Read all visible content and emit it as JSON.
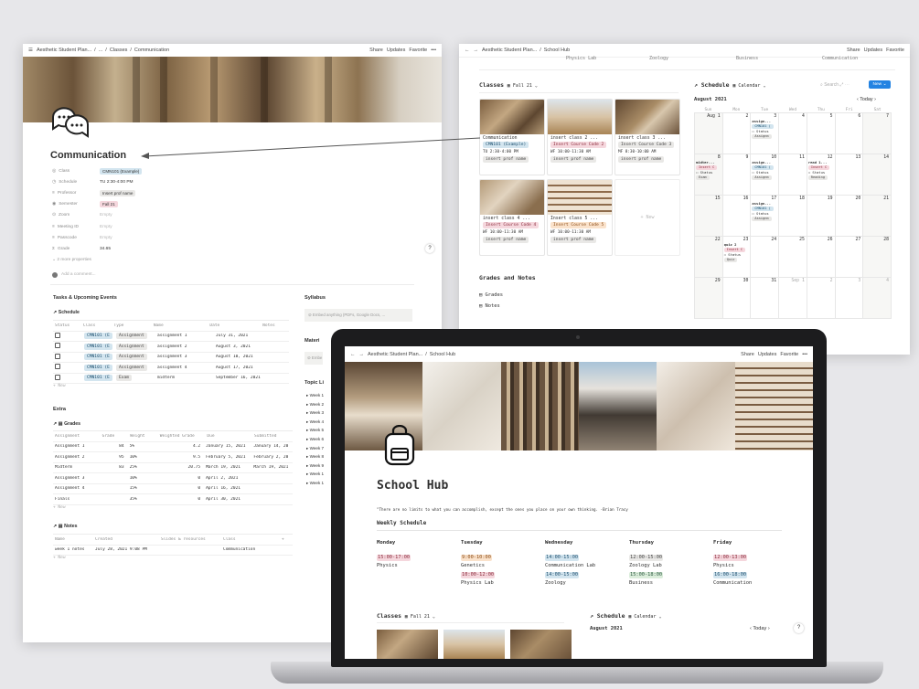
{
  "left_window": {
    "breadcrumb": [
      "Aesthetic Student Plan...",
      "...",
      "Classes",
      "Communication"
    ],
    "actions": [
      "Share",
      "Updates",
      "Favorite",
      "•••"
    ],
    "title": "Communication",
    "properties": [
      {
        "key": "Class",
        "value": "CMN101 (Example)",
        "style": "blue"
      },
      {
        "key": "Schedule",
        "value": "TU 2:30-4:00 PM",
        "style": "plain"
      },
      {
        "key": "Professor",
        "value": "Insert prof name",
        "style": "gray"
      },
      {
        "key": "Semester",
        "value": "Fall 21",
        "style": "pink"
      },
      {
        "key": "Zoom",
        "value": "Empty",
        "style": "empty"
      },
      {
        "key": "Meeting ID",
        "value": "Empty",
        "style": "empty"
      },
      {
        "key": "Passcode",
        "value": "Empty",
        "style": "empty"
      },
      {
        "key": "Grade",
        "value": "34.65",
        "style": "plain"
      }
    ],
    "more_props": "2 more properties",
    "comment_placeholder": "Add a comment...",
    "tasks_heading": "Tasks & Upcoming Events",
    "schedule_heading": "Schedule",
    "schedule_columns": [
      "Status",
      "Class",
      "Type",
      "Name",
      "Date",
      "Notes"
    ],
    "schedule_rows": [
      [
        "CMN101 (E",
        "Assignment",
        "assignment 1",
        "July 31, 2021"
      ],
      [
        "CMN101 (E",
        "Assignment",
        "assignment 2",
        "August 3, 2021"
      ],
      [
        "CMN101 (E",
        "Assignment",
        "assignment 3",
        "August 10, 2021"
      ],
      [
        "CMN101 (E",
        "Assignment",
        "assignment 4",
        "August 17, 2021"
      ],
      [
        "CMN101 (E",
        "Exam",
        "midterm",
        "September 16, 2021"
      ]
    ],
    "new_label": "+ New",
    "syllabus_heading": "Syllabus",
    "syllabus_embed": "Embed anything (PDFs, Google Docs, ...",
    "materials_heading": "Materi",
    "materials_embed": "Embe",
    "topics_heading": "Topic Li",
    "weeks": [
      "Week 1",
      "Week 2",
      "Week 3",
      "Week 4",
      "Week 5",
      "Week 6",
      "Week 7",
      "Week 8",
      "Week 9",
      "Week 1",
      "Week 1"
    ],
    "extra_heading": "Extra",
    "grades_heading": "Grades",
    "grades_columns": [
      "Assignment",
      "Grade",
      "Weight",
      "Weighted Grade",
      "Due",
      "Submitted"
    ],
    "grades_rows": [
      [
        "Assignment 1",
        "84",
        "5%",
        "4.2",
        "January 15, 2021",
        "January 14, 20"
      ],
      [
        "Assignment 2",
        "95",
        "10%",
        "9.5",
        "February 5, 2021",
        "February 2, 20"
      ],
      [
        "Midterm",
        "83",
        "25%",
        "20.75",
        "March 19, 2021",
        "March 19, 2021"
      ],
      [
        "Assignment 3",
        "",
        "10%",
        "0",
        "April 2, 2021",
        ""
      ],
      [
        "Assignment 4",
        "",
        "15%",
        "0",
        "April 16, 2021",
        ""
      ],
      [
        "Finals",
        "",
        "35%",
        "0",
        "April 30, 2021",
        ""
      ]
    ],
    "notes_heading": "Notes",
    "notes_columns": [
      "Name",
      "Created",
      "Slides & resources",
      "Class",
      "+"
    ],
    "notes_rows": [
      [
        "week 1 notes",
        "July 28, 2021 9:08 PM",
        "",
        "Communication"
      ]
    ]
  },
  "right_window": {
    "breadcrumb": [
      "Aesthetic Student Plan...",
      "School Hub"
    ],
    "actions": [
      "Share",
      "Updates",
      "Favorite"
    ],
    "top_cut_labels": [
      "Physics Lab",
      "Zoology",
      "Business",
      "Communication"
    ],
    "classes_heading": "Classes",
    "classes_view": "Fall 21",
    "cards": [
      {
        "title": "Communication",
        "code": "CMN101 (Example)",
        "code_style": "blue",
        "time": "TU 2:30-4:00 PM",
        "prof": "insert prof name"
      },
      {
        "title": "insert class 2 ...",
        "code": "Insert Course Code 2",
        "code_style": "pink",
        "time": "WF 10:00-11:30 AM",
        "prof": "insert prof name"
      },
      {
        "title": "insert class 3 ...",
        "code": "Insert Course Code 3",
        "code_style": "gray",
        "time": "MF 8:30-10:00 AM",
        "prof": "insert prof name"
      },
      {
        "title": "insert class 4 ...",
        "code": "Insert Course Code 4",
        "code_style": "pink",
        "time": "WF 10:00-11:30 AM",
        "prof": "insert prof name"
      },
      {
        "title": "Insert class 5 ...",
        "code": "Insert Course Code 5",
        "code_style": "orange",
        "time": "WF 10:00-11:30 AM",
        "prof": "insert prof name"
      }
    ],
    "new_card": "+ New",
    "grades_notes_heading": "Grades and Notes",
    "links": [
      "Grades",
      "Notes"
    ],
    "schedule_heading": "Schedule",
    "schedule_view": "Calendar",
    "search_label": "Search",
    "new_button": "New",
    "month": "August 2021",
    "today": "Today",
    "weekdays": [
      "Sun",
      "Mon",
      "Tue",
      "Wed",
      "Thu",
      "Fri",
      "Sat"
    ],
    "days": [
      [
        "Aug 1",
        "2",
        "3",
        "4",
        "5",
        "6",
        "7"
      ],
      [
        "8",
        "9",
        "10",
        "11",
        "12",
        "13",
        "14"
      ],
      [
        "15",
        "16",
        "17",
        "18",
        "19",
        "20",
        "21"
      ],
      [
        "22",
        "23",
        "24",
        "25",
        "26",
        "27",
        "28"
      ],
      [
        "29",
        "30",
        "31",
        "Sep 1",
        "2",
        "3",
        "4"
      ]
    ],
    "events": [
      {
        "week": 0,
        "day": 2,
        "title": "assign...",
        "tag": "CMN101 (",
        "status": "Status",
        "type": "Assignm"
      },
      {
        "week": 1,
        "day": 0,
        "title": "midter...",
        "tag": "Insert C",
        "status": "Status",
        "type": "Exam"
      },
      {
        "week": 1,
        "day": 2,
        "title": "assign...",
        "tag": "CMN101 (",
        "status": "Status",
        "type": "Assignm"
      },
      {
        "week": 1,
        "day": 4,
        "title": "read 1...",
        "tag": "Insert C",
        "status": "Status",
        "type": "Reading"
      },
      {
        "week": 2,
        "day": 2,
        "title": "assign...",
        "tag": "CMN101 (",
        "status": "Status",
        "type": "Assignm"
      },
      {
        "week": 3,
        "day": 1,
        "title": "quiz 2",
        "tag": "Insert C",
        "status": "Status",
        "type": "Quiz"
      }
    ]
  },
  "laptop_screen": {
    "breadcrumb": [
      "Aesthetic Student Plan...",
      "School Hub"
    ],
    "actions": [
      "Share",
      "Updates",
      "Favorite",
      "•••"
    ],
    "title": "School Hub",
    "quote": "\"There are no limits to what you can accomplish, except the ones you place on your own thinking. -Brian Tracy",
    "weekly_heading": "Weekly Schedule",
    "days": [
      {
        "day": "Monday",
        "slots": [
          {
            "time": "15:00-17:00",
            "color": "pink",
            "name": "Physics"
          }
        ]
      },
      {
        "day": "Tuesday",
        "slots": [
          {
            "time": "9:00-10:00",
            "color": "orange",
            "name": "Genetics"
          },
          {
            "time": "10:00-12:00",
            "color": "pink",
            "name": "Physics Lab"
          }
        ]
      },
      {
        "day": "Wednesday",
        "slots": [
          {
            "time": "14:00-15:00",
            "color": "blue",
            "name": "Communication Lab"
          },
          {
            "time": "14:00-15:00",
            "color": "blue",
            "name": "Zoology"
          }
        ]
      },
      {
        "day": "Thursday",
        "slots": [
          {
            "time": "12:00-15:00",
            "color": "gray",
            "name": "Zoology Lab"
          },
          {
            "time": "15:00-18:00",
            "color": "green",
            "name": "Business"
          }
        ]
      },
      {
        "day": "Friday",
        "slots": [
          {
            "time": "12:00-13:00",
            "color": "pink",
            "name": "Physics"
          },
          {
            "time": "16:00-18:00",
            "color": "blue",
            "name": "Communication"
          }
        ]
      }
    ],
    "classes_heading": "Classes",
    "classes_view": "Fall 21",
    "schedule_heading": "Schedule",
    "schedule_view": "Calendar",
    "month": "August 2021",
    "today": "Today",
    "help": "?"
  }
}
